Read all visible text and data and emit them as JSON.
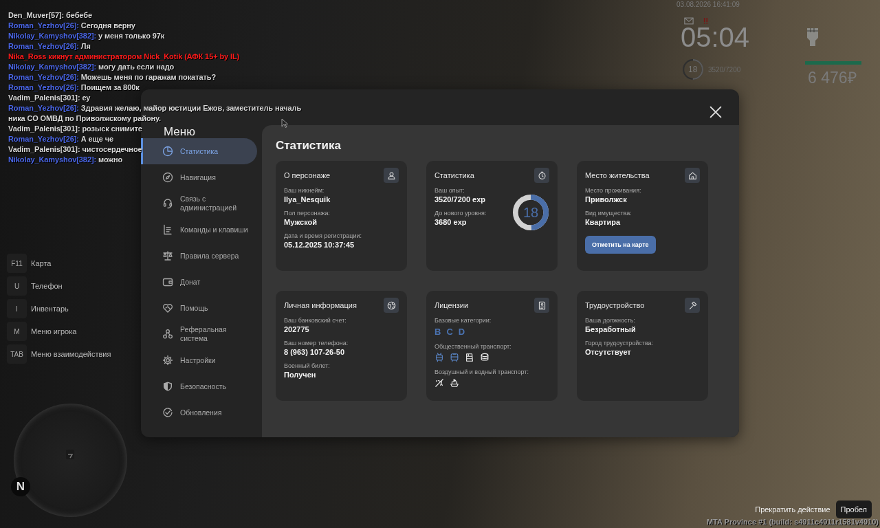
{
  "chat": [
    {
      "kind": "message",
      "name": "Den_Muver[57]:",
      "text": "бебебе",
      "color": "#d8d8d8"
    },
    {
      "kind": "message",
      "name": "Roman_Yezhov[26]:",
      "text": "Сегодня верну",
      "color": "#4a66e8"
    },
    {
      "kind": "message",
      "name": "Nikolay_Kamyshov[382]:",
      "text": "у меня только 97к",
      "color": "#4a66e8"
    },
    {
      "kind": "message",
      "name": "Roman_Yezhov[26]:",
      "text": "Ля",
      "color": "#4a66e8"
    },
    {
      "kind": "notice",
      "text": "Nika_Ross кикнут администратором Nick_Kotik (АФК 15+ by IL)",
      "color": "#ff1a1a"
    },
    {
      "kind": "message",
      "name": "Nikolay_Kamyshov[382]:",
      "text": "могу дать если надо",
      "color": "#4a66e8"
    },
    {
      "kind": "message",
      "name": "Roman_Yezhov[26]:",
      "text": "Можешь меня по гаражам покатать?",
      "color": "#4a66e8"
    },
    {
      "kind": "message",
      "name": "Roman_Yezhov[26]:",
      "text": "Поищем за 800к",
      "color": "#4a66e8"
    },
    {
      "kind": "message",
      "name": "Vadim_Palenis[301]:",
      "text": "еу",
      "color": "#d8d8d8"
    },
    {
      "kind": "message",
      "name": "Roman_Yezhov[26]:",
      "text": "Здравия желаю, майор юстиции Ежов, заместитель началь",
      "color": "#4a66e8"
    },
    {
      "kind": "continuation",
      "text": "ника СО ОМВД по Приволжскому району.",
      "color": "#d8d8d8"
    },
    {
      "kind": "message",
      "name": "Vadim_Palenis[301]:",
      "text": "розыск снимите",
      "color": "#d8d8d8"
    },
    {
      "kind": "message",
      "name": "Roman_Yezhov[26]:",
      "text": "А еще че",
      "color": "#4a66e8"
    },
    {
      "kind": "message",
      "name": "Vadim_Palenis[301]:",
      "text": "чистосердечное",
      "color": "#d8d8d8"
    },
    {
      "kind": "message",
      "name": "Nikolay_Kamyshov[382]:",
      "text": "можно",
      "color": "#4a66e8"
    }
  ],
  "hud": {
    "datetime": "03.08.2026 16:41:09",
    "time": "05:04",
    "player_level": "18",
    "level_ring": {
      "level": 0.5
    },
    "experience": "3520/7200",
    "status_bar": {
      "level": 1
    },
    "money": "6 476₽"
  },
  "hotkeys": [
    {
      "key": "F11",
      "label": "Карта"
    },
    {
      "key": "U",
      "label": "Телефон"
    },
    {
      "key": "I",
      "label": "Инвентарь"
    },
    {
      "key": "M",
      "label": "Меню игрока"
    },
    {
      "key": "TAB",
      "label": "Меню взаимодействия"
    }
  ],
  "minimap": {
    "compass": "N"
  },
  "menu": {
    "title": "Меню",
    "sidebar": [
      {
        "label": "Статистика",
        "selected": true
      },
      {
        "label": "Навигация",
        "selected": false
      },
      {
        "label": "Связь с администрацией",
        "selected": false
      },
      {
        "label": "Команды и клавиши",
        "selected": false
      },
      {
        "label": "Правила сервера",
        "selected": false
      },
      {
        "label": "Донат",
        "selected": false
      },
      {
        "label": "Помощь",
        "selected": false
      },
      {
        "label": "Реферальная система",
        "selected": false
      },
      {
        "label": "Настройки",
        "selected": false
      },
      {
        "label": "Безопасность",
        "selected": false
      },
      {
        "label": "Обновления",
        "selected": false
      }
    ],
    "heading": "Статистика",
    "cards": [
      {
        "kind": "info",
        "title": "О персонаже",
        "fields": [
          {
            "label": "Ваш никнейм:",
            "value": "Ilya_Nesquik"
          },
          {
            "label": "Пол персонажа:",
            "value": "Мужской"
          },
          {
            "label": "Дата и время регистрации:",
            "value": "05.12.2025 10:37:45"
          }
        ]
      },
      {
        "kind": "experience",
        "title": "Статистика",
        "fields": [
          {
            "label": "Ваш опыт:",
            "value": "3520/7200 exp"
          },
          {
            "label": "До нового уровня:",
            "value": "3680 exp"
          }
        ],
        "ring": {
          "label": "18",
          "level": 0.49
        }
      },
      {
        "kind": "info",
        "title": "Место жительства",
        "fields": [
          {
            "label": "Место проживания:",
            "value": "Приволжск"
          },
          {
            "label": "Вид имущества:",
            "value": "Квартира"
          }
        ],
        "button": "Отметить на карте"
      },
      {
        "kind": "info",
        "title": "Личная информация",
        "fields": [
          {
            "label": "Ваш банковский счет:",
            "value": "202775"
          },
          {
            "label": "Ваш номер телефона:",
            "value": "8 (963) 107-26-50"
          },
          {
            "label": "Военный билет:",
            "value": "Получен"
          }
        ]
      },
      {
        "kind": "licenses",
        "title": "Лицензии",
        "groups": [
          {
            "label": "Базовые категории:",
            "kind": "letters",
            "items": [
              {
                "letter": "B",
                "licensed": true
              },
              {
                "letter": "C",
                "licensed": true
              },
              {
                "letter": "D",
                "licensed": true
              }
            ]
          },
          {
            "label": "Общественный транспорт:",
            "kind": "icons",
            "items": [
              {
                "licensed": true
              },
              {
                "licensed": true
              },
              {
                "licensed": false
              },
              {
                "licensed": false
              }
            ]
          },
          {
            "label": "Воздушный и водный транспорт:",
            "kind": "icons",
            "items": [
              {
                "licensed": false
              },
              {
                "licensed": false
              }
            ]
          }
        ]
      },
      {
        "kind": "info",
        "title": "Трудоустройство",
        "fields": [
          {
            "label": "Ваша должность:",
            "value": "Безработный"
          },
          {
            "label": "Город трудоустройства:",
            "value": "Отсутствует"
          }
        ]
      }
    ]
  },
  "action_hint": {
    "label": "Прекратить действие",
    "key": "Пробел"
  },
  "build_info": "MTA Province #1 (build: s4911c4911r1581v4910)"
}
